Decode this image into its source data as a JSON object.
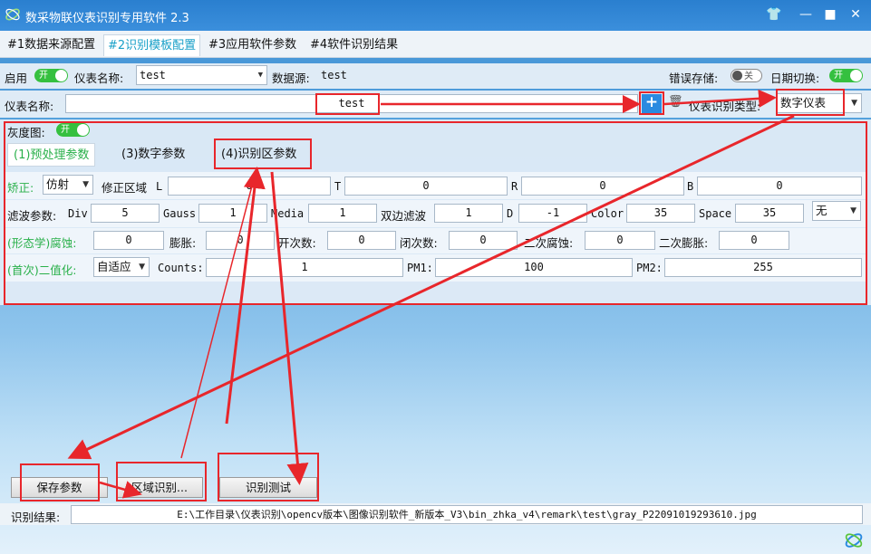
{
  "window": {
    "title": "数采物联仪表识别专用软件 2.3"
  },
  "tabs": [
    "#1数据来源配置",
    "#2识别模板配置",
    "#3应用软件参数",
    "#4软件识别结果"
  ],
  "row1": {
    "enable_label": "启用",
    "enable_state": "开",
    "meter_name_label": "仪表名称:",
    "meter_name_value": "test",
    "data_source_label": "数据源:",
    "data_source_value": "test",
    "error_save_label": "错误存储:",
    "error_save_state": "关",
    "date_switch_label": "日期切换:",
    "date_switch_state": "开"
  },
  "row2": {
    "meter_name_label": "仪表名称:",
    "meter_name_value": "test",
    "add_icon": "plus-icon",
    "delete_icon": "trash-icon",
    "type_label": "仪表识别类型:",
    "type_value": "数字仪表"
  },
  "gray": {
    "label": "灰度图:",
    "state": "开"
  },
  "subtabs": [
    "(1)预处理参数",
    "(3)数字参数",
    "(4)识别区参数"
  ],
  "correction": {
    "label": "矫正:",
    "mode": "仿射",
    "region_label": "修正区域",
    "L_label": "L",
    "L": "0",
    "T_label": "T",
    "T": "0",
    "R_label": "R",
    "R": "0",
    "B_label": "B",
    "B": "0"
  },
  "filter": {
    "label": "滤波参数:",
    "div_label": "Div",
    "div": "5",
    "gauss_label": "Gauss",
    "gauss": "1",
    "media_label": "Media",
    "media": "1",
    "bilateral_label": "双边滤波",
    "bilateral": "1",
    "d_label": "D",
    "d": "-1",
    "color_label": "Color",
    "color": "35",
    "space_label": "Space",
    "space": "35",
    "mode": "无"
  },
  "morph": {
    "label": "(形态学)腐蚀:",
    "erode": "0",
    "dilate_label": "膨胀:",
    "dilate": "0",
    "open_label": "开次数:",
    "open": "0",
    "close_label": "闭次数:",
    "close": "0",
    "erode2_label": "二次腐蚀:",
    "erode2": "0",
    "dilate2_label": "二次膨胀:",
    "dilate2": "0"
  },
  "binarize": {
    "label": "(首次)二值化:",
    "mode": "自适应",
    "counts_label": "Counts:",
    "counts": "1",
    "pm1_label": "PM1:",
    "pm1": "100",
    "pm2_label": "PM2:",
    "pm2": "255"
  },
  "buttons": {
    "save": "保存参数",
    "region": "区域识别...",
    "test": "识别测试"
  },
  "result": {
    "label": "识别结果:",
    "value": "E:\\工作目录\\仪表识别\\opencv版本\\图像识别软件_新版本_V3\\bin_zhka_v4\\remark\\test\\gray_P22091019293610.jpg"
  },
  "colors": {
    "accent": "#19a0c8",
    "toggle_on": "#35c03f",
    "annotation": "#e8262b"
  }
}
